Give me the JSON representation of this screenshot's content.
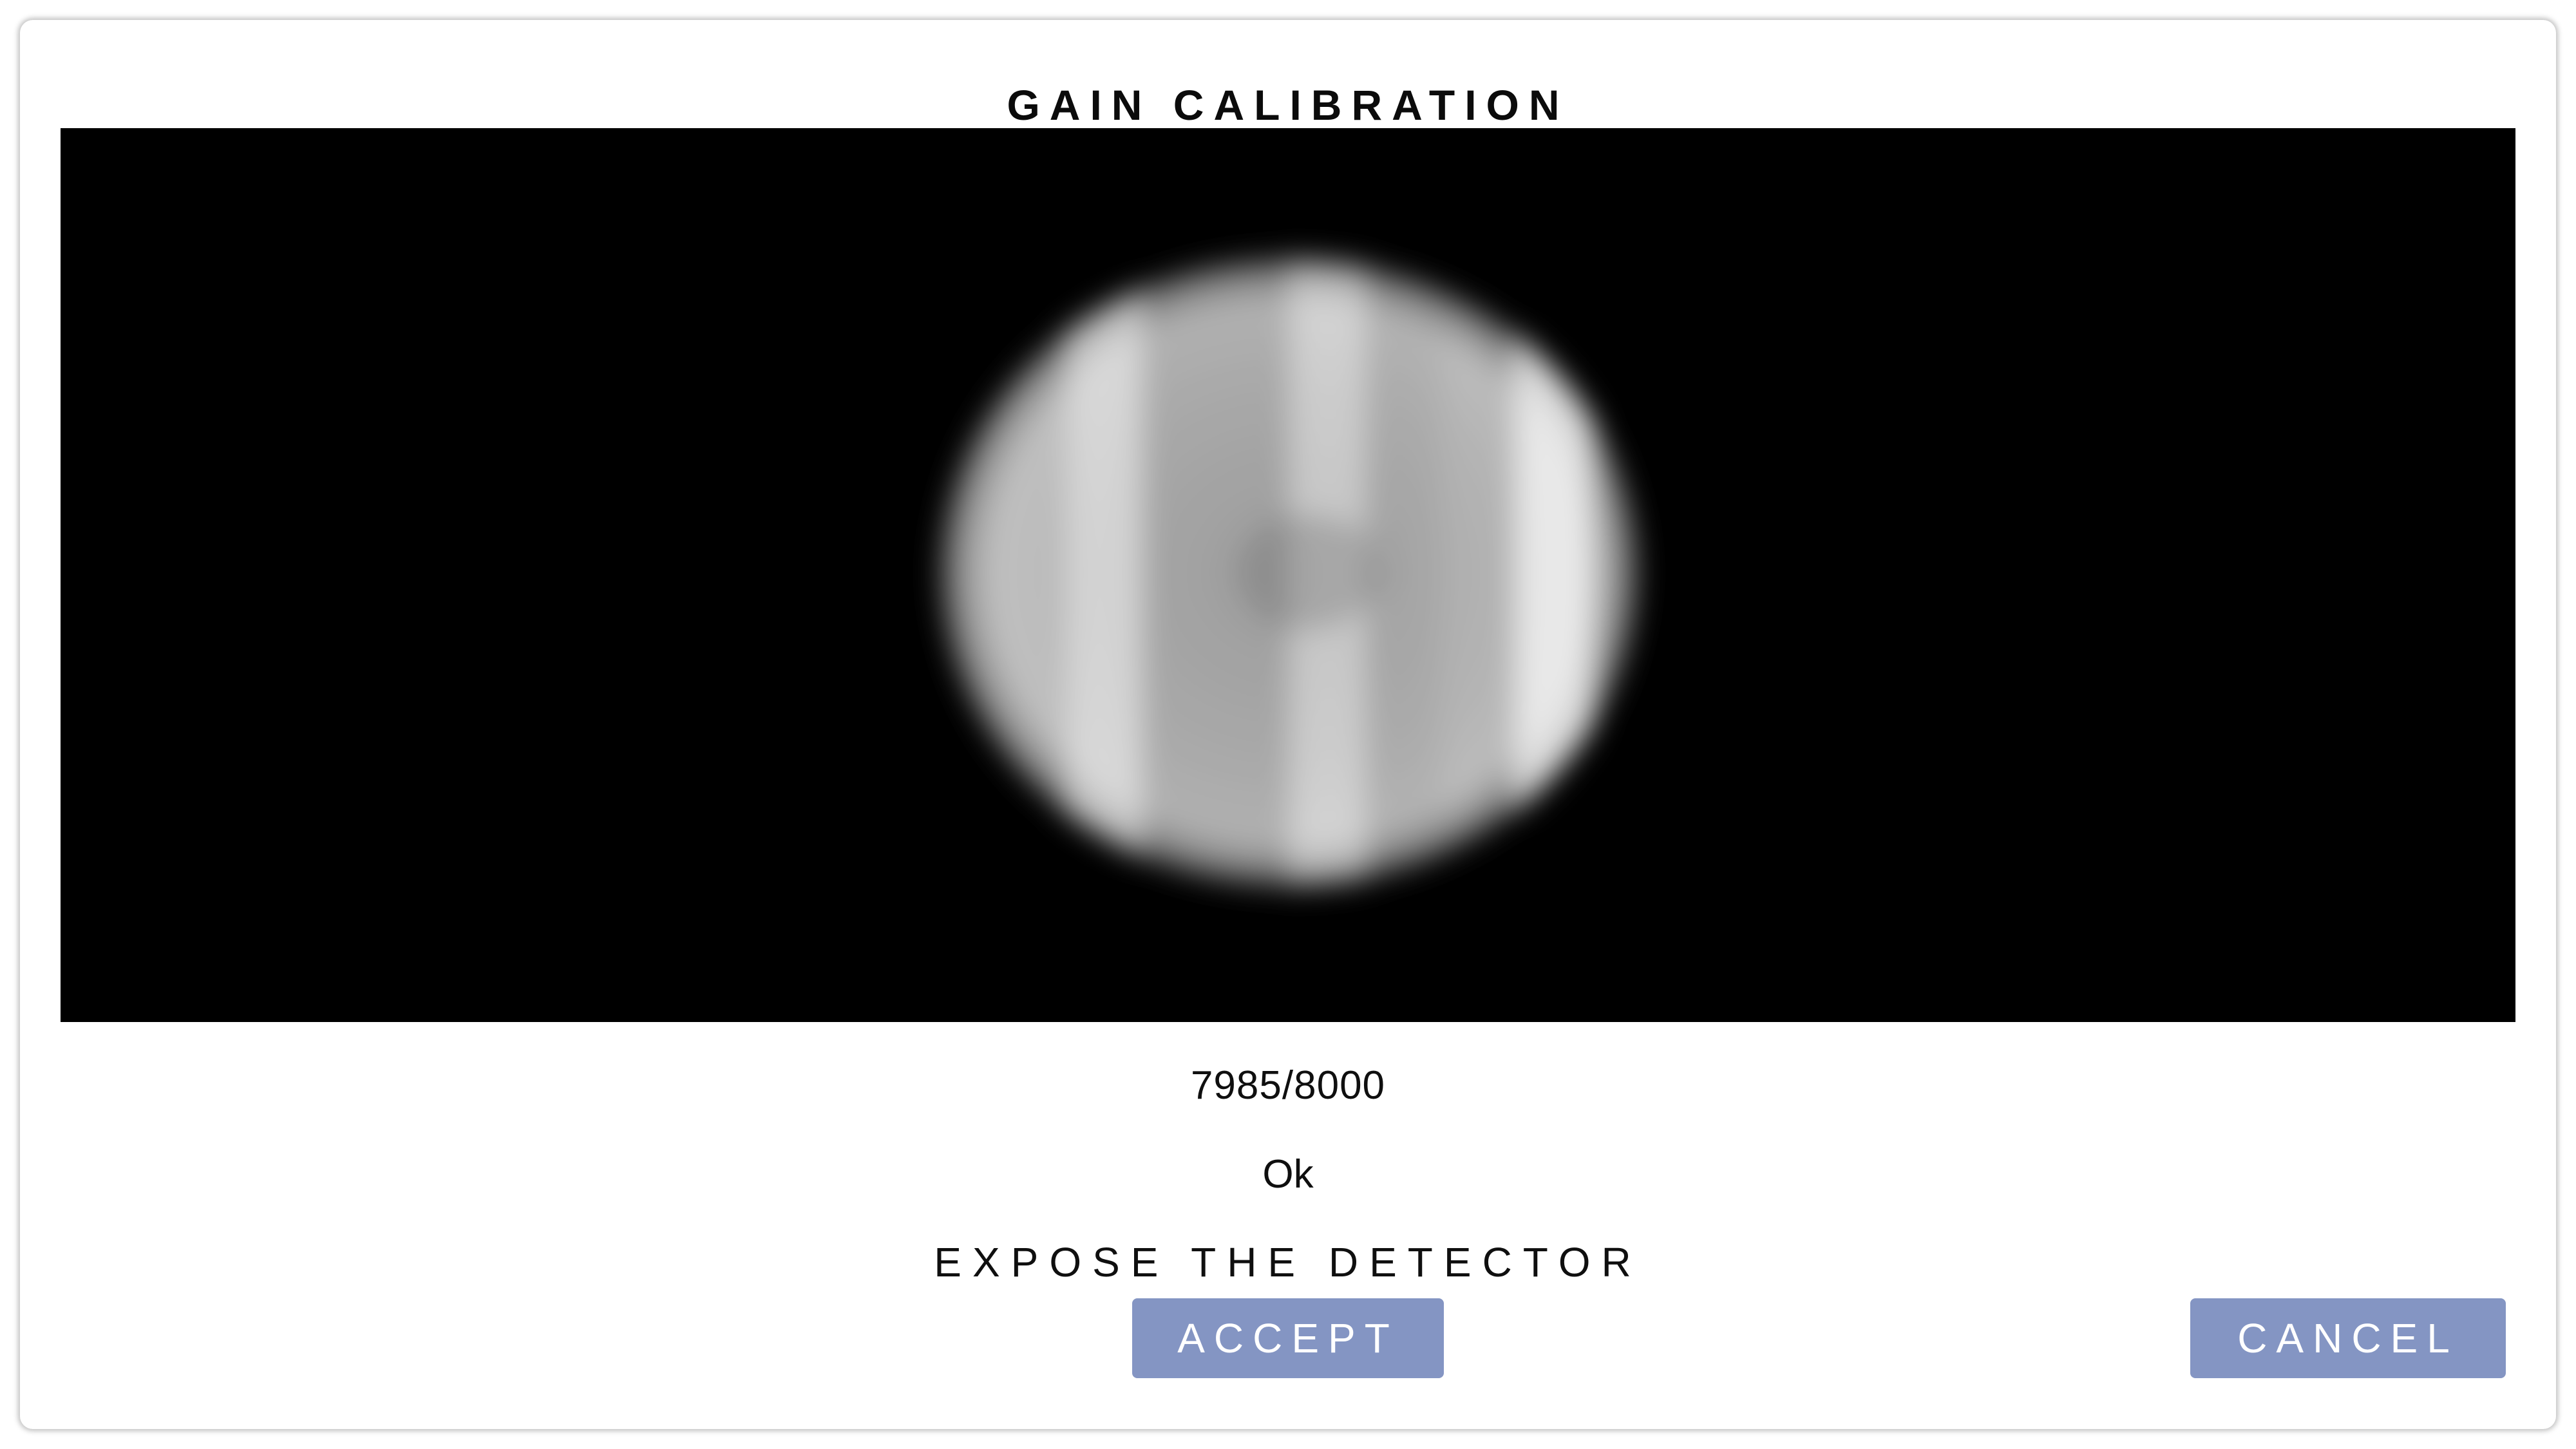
{
  "dialog": {
    "title": "GAIN CALIBRATION",
    "progress": "7985/8000",
    "result": "Ok",
    "instruction": "EXPOSE THE DETECTOR"
  },
  "image": {
    "icon": "detector-flat-field-image",
    "background_color": "#000000"
  },
  "buttons": {
    "accept_label": "ACCEPT",
    "cancel_label": "CANCEL",
    "color": "#8495c3"
  }
}
